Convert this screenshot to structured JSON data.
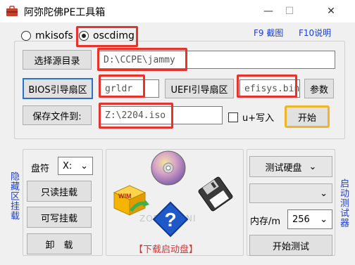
{
  "window": {
    "title": "阿弥陀佛PE工具箱",
    "minimize": "—",
    "maximize": "☐",
    "close": "✕"
  },
  "modes": {
    "mkisofs": "mkisofs",
    "oscdimg": "oscdimg",
    "selected": "oscdimg"
  },
  "hotkeys": {
    "screenshot": "F9 截图",
    "help": "F10说明"
  },
  "source": {
    "button": "选择源目录",
    "value": "D:\\CCPE\\jammy"
  },
  "boot": {
    "bios_button": "BIOS引导扇区",
    "bios_value": "grldr",
    "uefi_button": "UEFI引导扇区",
    "uefi_value": "efisys.bin",
    "params_button": "参数"
  },
  "save": {
    "button": "保存文件到:",
    "value": "Z:\\2204.iso",
    "checkbox_label": "u+写入",
    "start_button": "开始"
  },
  "left_panel": {
    "side_label": "隐藏区挂载",
    "drive_label": "盘符",
    "drive_value": "X:",
    "readonly_mount": "只读挂载",
    "writable_mount": "可写挂载",
    "unmount": "卸　载"
  },
  "center": {
    "wim_label": "WIM",
    "watermark": "ZOPE.NIDNI",
    "download_link": "【下载启动盘】"
  },
  "right_panel": {
    "side_label": "启动测试器",
    "test_disk": "测试硬盘",
    "disk_select": "",
    "memory_label": "内存/m",
    "memory_value": "256",
    "start_test": "开始测试"
  },
  "colors": {
    "highlight_red": "#e8332a",
    "start_border": "#f0b429",
    "blue_text": "#1a3fd1"
  }
}
